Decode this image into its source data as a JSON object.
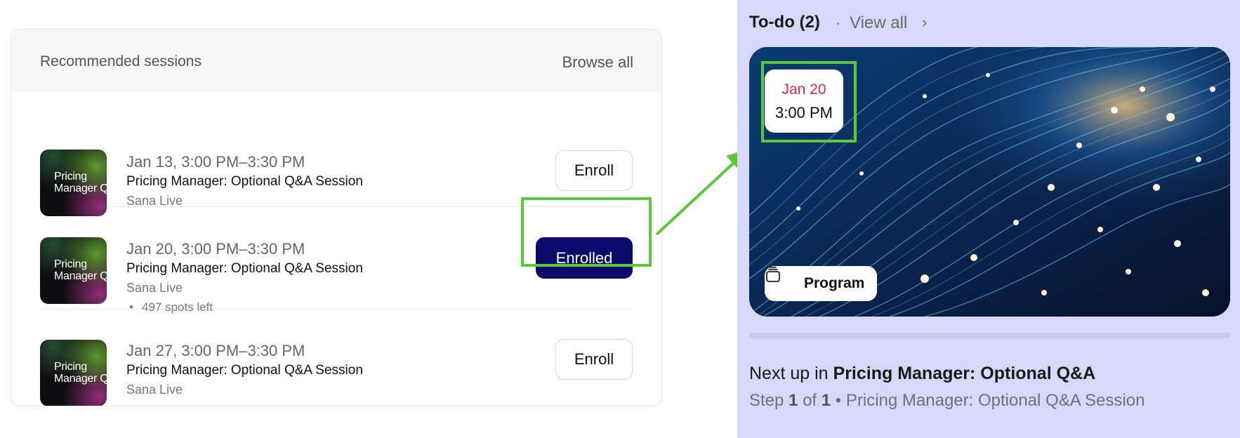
{
  "recommended": {
    "title": "Recommended sessions",
    "browse_all": "Browse all",
    "sessions": [
      {
        "when": "Jan 13, 3:00 PM–3:30 PM",
        "name": "Pricing Manager: Optional Q&A Session",
        "provider": "Sana Live",
        "thumb_text_1": "Pricing",
        "thumb_text_2": "Manager Q",
        "button": "Enroll",
        "enrolled": false
      },
      {
        "when": "Jan 20, 3:00 PM–3:30 PM",
        "name": "Pricing Manager: Optional Q&A Session",
        "provider": "Sana Live",
        "spots": "497 spots left",
        "thumb_text_1": "Pricing",
        "thumb_text_2": "Manager Q",
        "button": "Enrolled",
        "enrolled": true
      },
      {
        "when": "Jan 27, 3:00 PM–3:30 PM",
        "name": "Pricing Manager: Optional Q&A Session",
        "provider": "Sana Live",
        "thumb_text_1": "Pricing",
        "thumb_text_2": "Manager Q",
        "button": "Enroll",
        "enrolled": false
      }
    ]
  },
  "todo": {
    "title": "To-do (2)",
    "separator": "·",
    "view_all": "View all",
    "chevron": "›",
    "card": {
      "date": "Jan 20",
      "time": "3:00 PM",
      "program_label": "Program",
      "program_icon": "stack-icon"
    },
    "progress_fraction": 0,
    "next_up_prefix": "Next up in",
    "next_up_title": "Pricing Manager: Optional Q&A",
    "step_label": "Step",
    "step_current": "1",
    "step_of": "of",
    "step_total": "1",
    "step_bullet": "•",
    "step_session": "Pricing Manager: Optional Q&A Session"
  },
  "colors": {
    "enrolled_bg": "#0b0b6b",
    "highlight": "#5cc83a",
    "panel_bg": "#d8d8fb",
    "date_red": "#e0284a"
  }
}
